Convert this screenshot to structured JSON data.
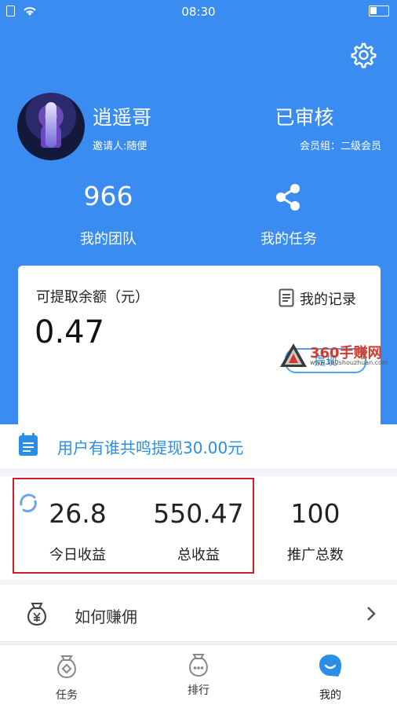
{
  "status_bar": {
    "time": "08:30"
  },
  "profile": {
    "username": "逍遥哥",
    "inviter": "邀请人:随便",
    "status": "已审核",
    "member_group": "会员组：二级会员"
  },
  "team": {
    "count": "966",
    "label": "我的团队"
  },
  "tasks": {
    "label": "我的任务"
  },
  "balance": {
    "label": "可提取余额（元）",
    "value": "0.47",
    "records_label": "我的记录"
  },
  "watermark": {
    "brand": "360手赚网",
    "url": "www.360shouzhuan.com",
    "button_text": "提现"
  },
  "notice": {
    "text": "用户有谁共鸣提现30.00元"
  },
  "stats": [
    {
      "value": "26.8",
      "label": "今日收益"
    },
    {
      "value": "550.47",
      "label": "总收益"
    },
    {
      "value": "100",
      "label": "推广总数"
    }
  ],
  "earn": {
    "label": "如何赚佣"
  },
  "tabs": [
    {
      "label": "任务"
    },
    {
      "label": "排行"
    },
    {
      "label": "我的"
    }
  ],
  "colors": {
    "primary": "#3b8cf0",
    "accent": "#2a8ee7",
    "highlight": "#d51c24"
  }
}
